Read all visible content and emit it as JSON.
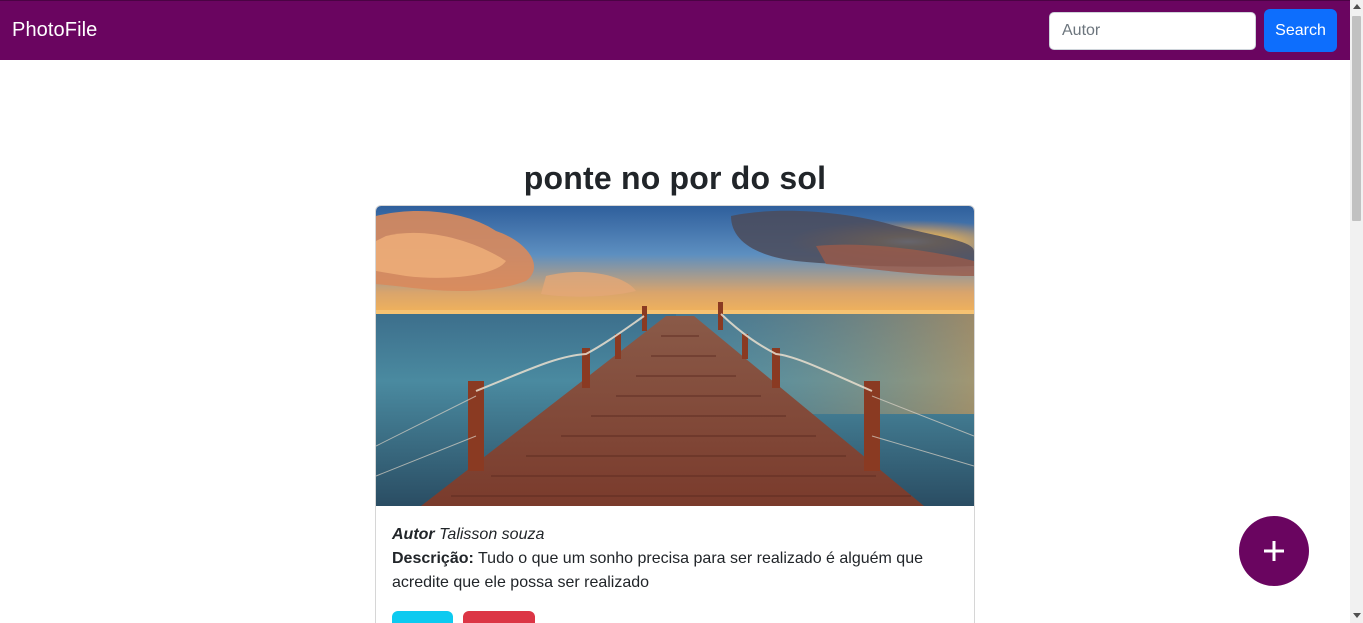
{
  "navbar": {
    "brand": "PhotoFile",
    "search_placeholder": "Autor",
    "search_value": "",
    "search_button": "Search",
    "background_color": "#6a0560",
    "button_color": "#0d6efd"
  },
  "photo": {
    "title": "ponte no por do sol",
    "image_icon": "pier-at-sunset-photo",
    "author_label": "Autor",
    "author_name": "Talisson souza",
    "description_label": "Descrição:",
    "description_text": "Tudo o que um sonho precisa para ser realizado é alguém que acredite que ele possa ser realizado",
    "edit_button_color": "#0dcaf0",
    "delete_button_color": "#dc3545"
  },
  "fab": {
    "label": "+",
    "icon": "plus-icon",
    "color": "#6a0560"
  }
}
